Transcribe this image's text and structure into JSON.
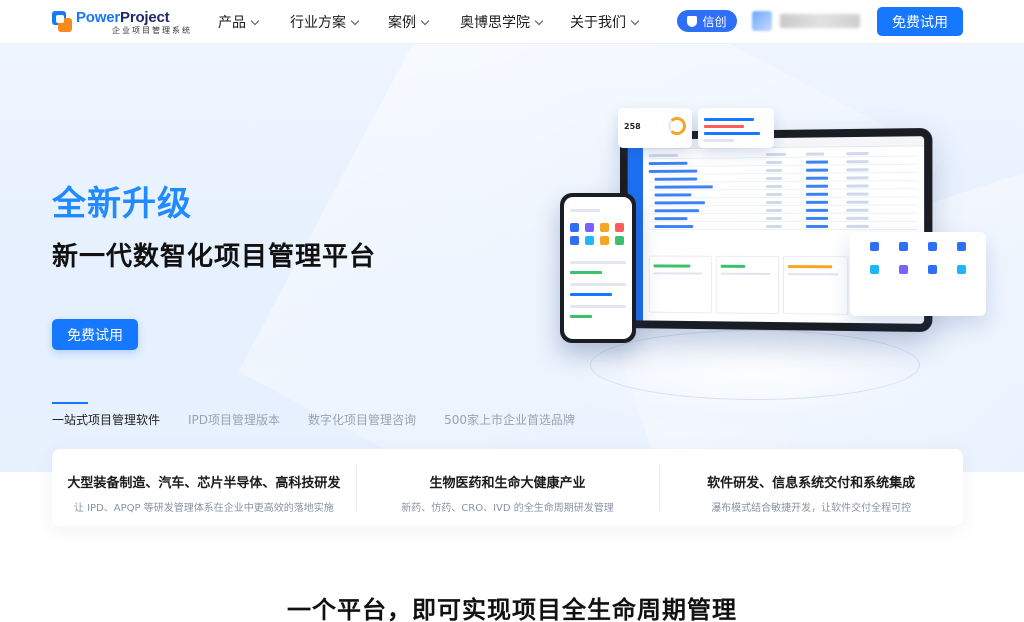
{
  "brand": {
    "name_blue": "Power",
    "name_dark": "Project",
    "subtitle": "企业项目管理系统"
  },
  "nav": {
    "items": [
      {
        "label": "产品"
      },
      {
        "label": "行业方案"
      },
      {
        "label": "案例"
      },
      {
        "label": "奥博思学院"
      },
      {
        "label": "关于我们"
      }
    ],
    "badge": "信创",
    "cta": "免费试用"
  },
  "hero": {
    "tag": "全新升级",
    "title": "新一代数智化项目管理平台",
    "cta": "免费试用",
    "tabs": [
      {
        "label": "一站式项目管理软件"
      },
      {
        "label": "IPD项目管理版本"
      },
      {
        "label": "数字化项目管理咨询"
      },
      {
        "label": "500家上市企业首选品牌"
      }
    ]
  },
  "illustration": {
    "metric": "258"
  },
  "industries": [
    {
      "title": "大型装备制造、汽车、芯片半导体、高科技研发",
      "desc": "让 IPD、APQP 等研发管理体系在企业中更高效的落地实施"
    },
    {
      "title": "生物医药和生命大健康产业",
      "desc": "新药、仿药、CRO、IVD 的全生命周期研发管理"
    },
    {
      "title": "软件研发、信息系统交付和系统集成",
      "desc": "瀑布模式结合敏捷开发，让软件交付全程可控"
    }
  ],
  "section": {
    "title": "一个平台，即可实现项目全生命周期管理"
  },
  "colors": {
    "primary": "#1677ff",
    "tag": "#1f8bff",
    "orange": "#f58a1f",
    "badge": "#2f6ff5"
  }
}
